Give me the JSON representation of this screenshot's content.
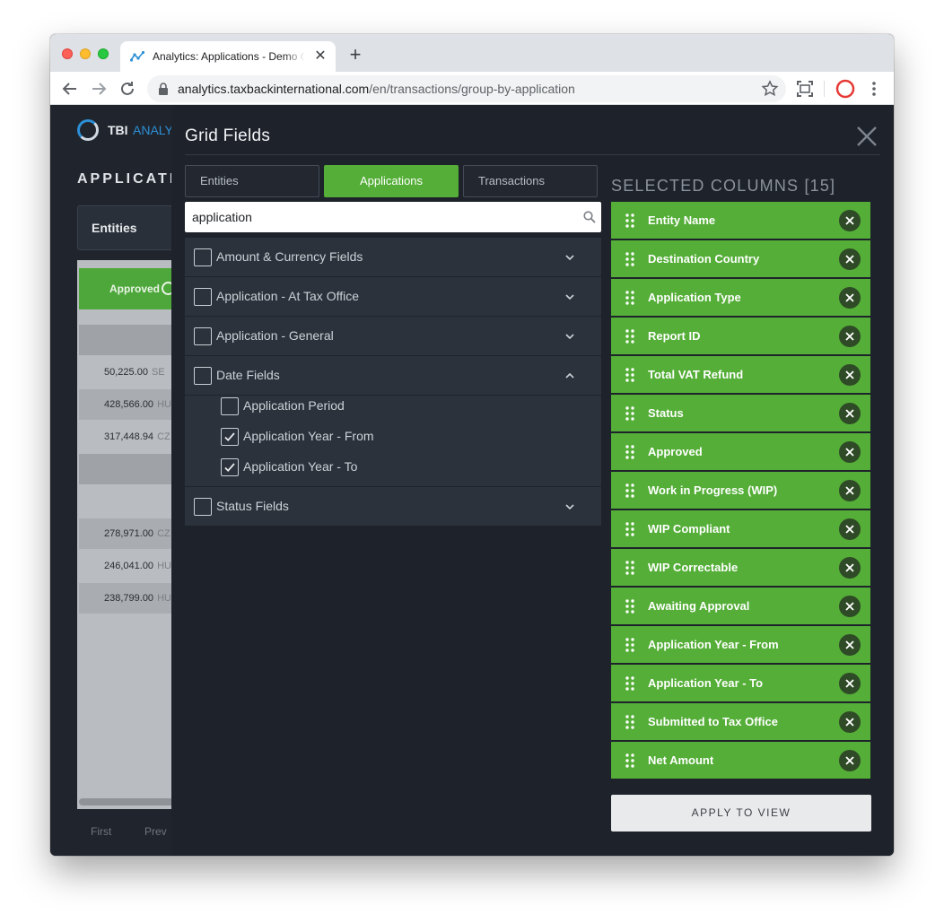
{
  "browser": {
    "tab_title": "Analytics: Applications - Demo Company",
    "url_host": "analytics.taxbackinternational.com",
    "url_path": "/en/transactions/group-by-application"
  },
  "background": {
    "logo_text": "TBI",
    "logo_text2": "ANALY",
    "page_title": "APPLICATION",
    "entities_label": "Entities",
    "approved_header": "Approved",
    "rows": [
      {
        "value": "50,225.00",
        "code": "SE"
      },
      {
        "value": "428,566.00",
        "code": "HU"
      },
      {
        "value": "317,448.94",
        "code": "CZ"
      },
      {
        "value": "278,971.00",
        "code": "CZ"
      },
      {
        "value": "246,041.00",
        "code": "HU"
      },
      {
        "value": "238,799.00",
        "code": "HU"
      }
    ],
    "pager_first": "First",
    "pager_prev": "Prev"
  },
  "modal": {
    "title": "Grid Fields",
    "tabs": [
      "Entities",
      "Applications",
      "Transactions"
    ],
    "active_tab": "Applications",
    "search_value": "application",
    "groups": [
      {
        "label": "Amount & Currency Fields",
        "expanded": false
      },
      {
        "label": "Application - At Tax Office",
        "expanded": false
      },
      {
        "label": "Application - General",
        "expanded": false
      },
      {
        "label": "Date Fields",
        "expanded": true
      },
      {
        "label": "Status Fields",
        "expanded": false
      }
    ],
    "date_fields": [
      {
        "label": "Application Period",
        "checked": false
      },
      {
        "label": "Application Year - From",
        "checked": true
      },
      {
        "label": "Application Year - To",
        "checked": true
      }
    ],
    "selected_title": "SELECTED COLUMNS [15]",
    "selected_columns": [
      "Entity Name",
      "Destination Country",
      "Application Type",
      "Report ID",
      "Total VAT Refund",
      "Status",
      "Approved",
      "Work in Progress (WIP)",
      "WIP Compliant",
      "WIP Correctable",
      "Awaiting Approval",
      "Application Year - From",
      "Application Year - To",
      "Submitted to Tax Office",
      "Net Amount"
    ],
    "apply_label": "APPLY TO VIEW"
  },
  "colors": {
    "accent_green": "#54ae37",
    "modal_bg": "#1e232b",
    "panel_bg": "#2c323b"
  }
}
